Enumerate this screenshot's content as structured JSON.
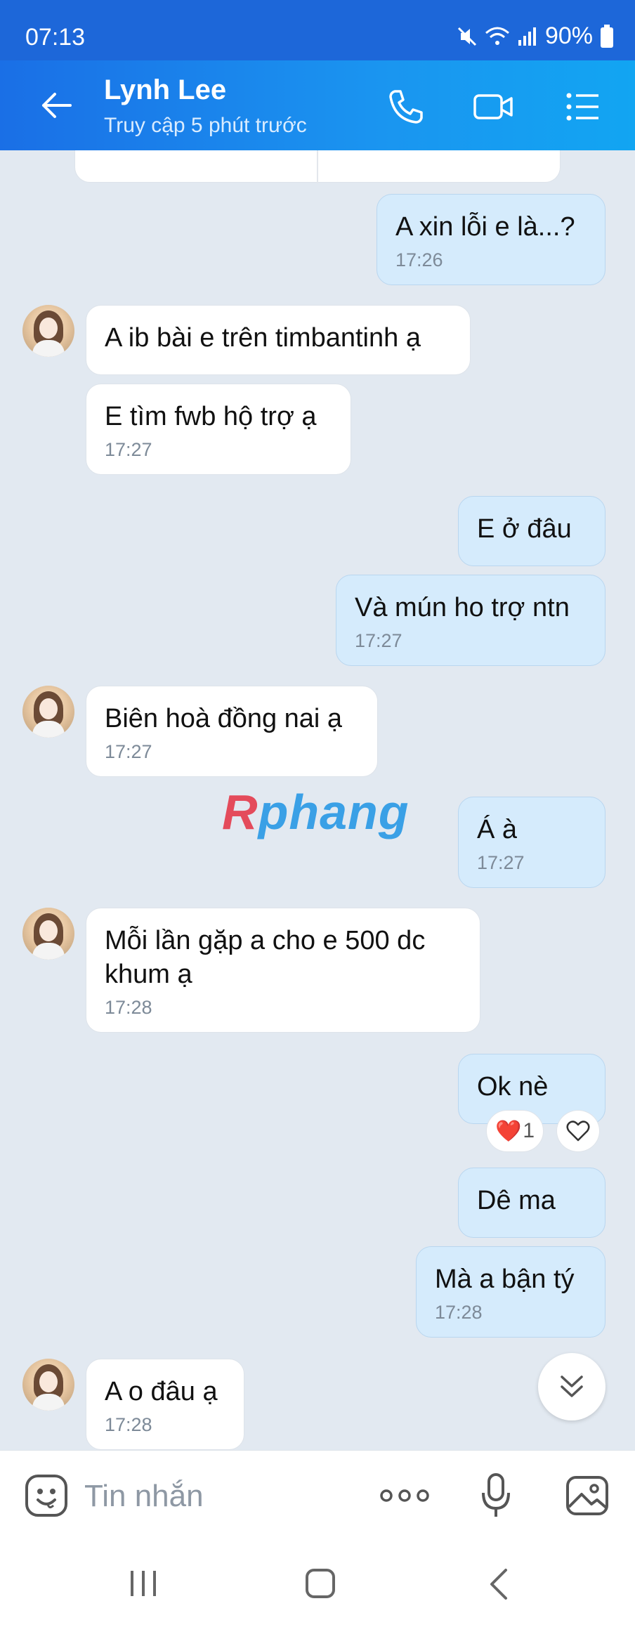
{
  "status_bar": {
    "time": "07:13",
    "battery": "90%"
  },
  "header": {
    "contact_name": "Lynh Lee",
    "last_seen": "Truy cập 5 phút trước"
  },
  "messages": [
    {
      "side": "out",
      "text": "A xin lỗi e là...?",
      "time": "17:26"
    },
    {
      "side": "in",
      "text": "A ib bài e trên timbantinh ạ",
      "time": ""
    },
    {
      "side": "in",
      "text": "E tìm fwb hộ trợ ạ",
      "time": "17:27"
    },
    {
      "side": "out",
      "text": "E ở đâu",
      "time": ""
    },
    {
      "side": "out",
      "text": "Và mún ho trợ ntn",
      "time": "17:27"
    },
    {
      "side": "in",
      "text": "Biên hoà đồng nai ạ",
      "time": "17:27"
    },
    {
      "side": "out",
      "text": "Á à",
      "time": "17:27"
    },
    {
      "side": "in",
      "text": "Mỗi lần gặp a cho e 500 dc khum ạ",
      "time": "17:28"
    },
    {
      "side": "out",
      "text": "Ok nè",
      "time": ""
    },
    {
      "side": "out",
      "text": "Dê ma",
      "time": ""
    },
    {
      "side": "out",
      "text": "Mà a bận tý",
      "time": "17:28"
    },
    {
      "side": "in",
      "text": "A o đâu ạ",
      "time": "17:28"
    }
  ],
  "reaction": {
    "emoji": "❤️",
    "count": "1"
  },
  "watermark": {
    "first": "R",
    "rest": "phang"
  },
  "composer": {
    "placeholder": "Tin nhắn"
  },
  "icons": {
    "back": "back-arrow-icon",
    "call": "phone-icon",
    "video": "video-camera-icon",
    "menu": "list-menu-icon",
    "sticker": "emoji-sticker-icon",
    "more": "more-dots-icon",
    "mic": "microphone-icon",
    "gallery": "image-gallery-icon",
    "scroll": "double-chevron-down-icon",
    "heart": "heart-outline-icon"
  },
  "colors": {
    "header": "#1a6fe6",
    "outgoing_bubble": "#d5ebfc",
    "incoming_bubble": "#ffffff",
    "background": "#e2e9f1"
  }
}
